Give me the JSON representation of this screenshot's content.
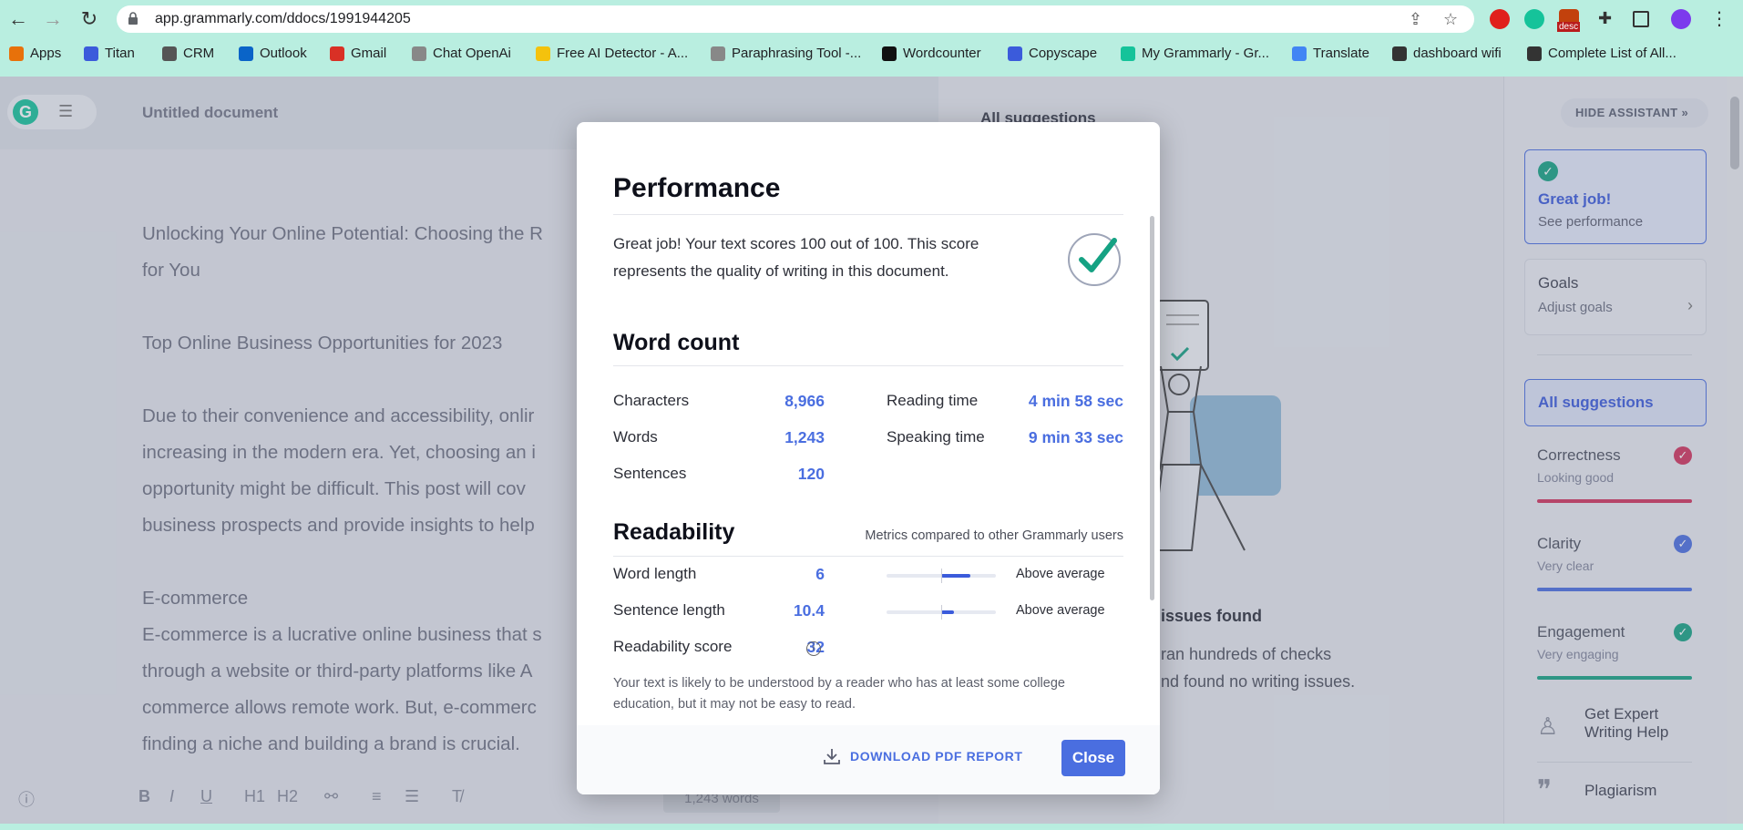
{
  "browser": {
    "url": "app.grammarly.com/ddocs/1991944205",
    "bookmarks": [
      {
        "label": "Apps",
        "icon": "apps-grid-icon"
      },
      {
        "label": "Titan",
        "icon": "mail-icon"
      },
      {
        "label": "CRM",
        "icon": "crm-icon"
      },
      {
        "label": "Outlook",
        "icon": "outlook-icon"
      },
      {
        "label": "Gmail",
        "icon": "gmail-icon"
      },
      {
        "label": "Chat OpenAi",
        "icon": "openai-icon"
      },
      {
        "label": "Free AI Detector - A...",
        "icon": "detector-icon"
      },
      {
        "label": "Paraphrasing Tool -...",
        "icon": "quill-icon"
      },
      {
        "label": "Wordcounter",
        "icon": "w-icon"
      },
      {
        "label": "Copyscape",
        "icon": "c-icon"
      },
      {
        "label": "My Grammarly - Gr...",
        "icon": "grammarly-icon"
      },
      {
        "label": "Translate",
        "icon": "translate-icon"
      },
      {
        "label": "dashboard wifi",
        "icon": "globe-icon"
      },
      {
        "label": "Complete List of All...",
        "icon": "globe-icon"
      }
    ],
    "ext_badge": "desc"
  },
  "editor": {
    "doc_title": "Untitled document",
    "paragraphs": [
      "Unlocking Your Online Potential: Choosing the R",
      "for You",
      "Top Online Business Opportunities for 2023",
      "Due to their convenience and accessibility, onlir",
      "increasing in the modern era. Yet, choosing an i",
      "opportunity might be difficult. This post will cov",
      "business prospects and provide insights to help",
      "E-commerce",
      "E-commerce is a lucrative online business that s",
      "through a website or third-party platforms like A",
      "commerce allows remote work. But, e-commerc",
      "finding a niche and building a brand is crucial."
    ],
    "word_count_pill": "1,243 words"
  },
  "suggestions_panel": {
    "header": "All suggestions",
    "no_issues_title": "issues found",
    "no_issues_line1": "ran hundreds of checks",
    "no_issues_line2": "nd found no writing issues."
  },
  "sidebar": {
    "hide_assistant": "HIDE ASSISTANT",
    "great_job": "Great job!",
    "see_performance": "See performance",
    "goals": "Goals",
    "adjust_goals": "Adjust goals",
    "all_suggestions": "All suggestions",
    "categories": [
      {
        "name": "Correctness",
        "status": "Looking good",
        "color": "#d2335c"
      },
      {
        "name": "Clarity",
        "status": "Very clear",
        "color": "#4a6ee0"
      },
      {
        "name": "Engagement",
        "status": "Very engaging",
        "color": "#15a283"
      }
    ],
    "expert_help_line1": "Get Expert",
    "expert_help_line2": "Writing Help",
    "plagiarism": "Plagiarism"
  },
  "modal": {
    "performance_title": "Performance",
    "performance_text_line1": "Great job! Your text scores 100 out of 100. This score",
    "performance_text_line2": "represents the quality of writing in this document.",
    "word_count_title": "Word count",
    "stats": {
      "characters_label": "Characters",
      "characters_value": "8,966",
      "words_label": "Words",
      "words_value": "1,243",
      "sentences_label": "Sentences",
      "sentences_value": "120",
      "reading_time_label": "Reading time",
      "reading_time_value": "4 min 58 sec",
      "speaking_time_label": "Speaking time",
      "speaking_time_value": "9 min 33 sec"
    },
    "readability_title": "Readability",
    "readability_note": "Metrics compared to other Grammarly users",
    "readability": {
      "word_length_label": "Word length",
      "word_length_value": "6",
      "word_length_rating": "Above average",
      "word_length_level": 0.77,
      "sentence_length_label": "Sentence length",
      "sentence_length_value": "10.4",
      "sentence_length_rating": "Above average",
      "sentence_length_level": 0.62,
      "score_label": "Readability score",
      "score_value": "32"
    },
    "readability_desc_line1": "Your text is likely to be understood by a reader who has at least some college",
    "readability_desc_line2": "education, but it may not be easy to read.",
    "download_label": "DOWNLOAD PDF REPORT",
    "close_label": "Close",
    "accent": "#4a6ee0",
    "check_color": "#15a283"
  }
}
